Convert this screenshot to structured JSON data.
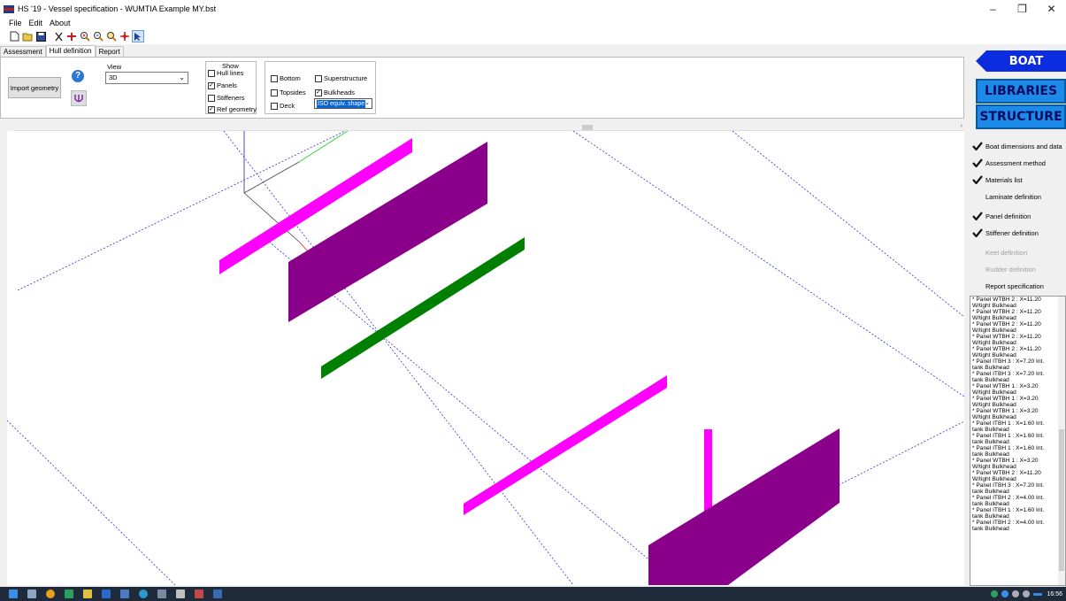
{
  "window": {
    "title": "HS '19 - Vessel specification - WUMTIA Example MY.bst",
    "minimize": "–",
    "maximize": "❐",
    "close": "✕"
  },
  "menu": [
    "File",
    "Edit",
    "About"
  ],
  "toolbar": [
    "new-icon",
    "open-icon",
    "save-icon",
    "cut-icon",
    "split-icon",
    "zoom-in-icon",
    "zoom-out-icon",
    "zoom-fit-icon",
    "pan-icon",
    "select-icon"
  ],
  "tabs": [
    {
      "label": "Assessment",
      "active": false
    },
    {
      "label": "Hull definition",
      "active": true
    },
    {
      "label": "Report",
      "active": false
    }
  ],
  "hull": {
    "import_label": "Import geometry",
    "help_glyph": "?",
    "view_label": "View",
    "view_value": "3D",
    "show_title": "Show",
    "show": [
      {
        "label": "Hull lines",
        "checked": false
      },
      {
        "label": "Panels",
        "checked": true
      },
      {
        "label": "Stiffeners",
        "checked": false
      },
      {
        "label": "Ref geometry",
        "checked": true
      }
    ],
    "regions": [
      {
        "label": "Bottom",
        "checked": false
      },
      {
        "label": "Topsides",
        "checked": false
      },
      {
        "label": "Deck",
        "checked": false
      },
      {
        "label": "Superstructure",
        "checked": false
      },
      {
        "label": "Bulkheads",
        "checked": true
      }
    ],
    "shape_value": "ISO equiv. shape"
  },
  "colors": {
    "magenta": "#ff00ff",
    "purple": "#8b008b",
    "green": "#008000",
    "boat_blue": "#0c2ce0",
    "lib_blue": "#1c8ae8"
  },
  "sidebar": {
    "boat": "BOAT",
    "libraries": "LIBRARIES",
    "structure": "STRUCTURE",
    "nav": [
      {
        "label": "Boat dimensions and data",
        "done": true,
        "disabled": false
      },
      {
        "label": "Assessment method",
        "done": true,
        "disabled": false
      },
      {
        "label": "Materials list",
        "done": true,
        "disabled": false
      },
      {
        "label": "Laminate definition",
        "done": false,
        "disabled": false
      },
      {
        "label": "Panel definition",
        "done": true,
        "disabled": false
      },
      {
        "label": "Stiffener definition",
        "done": true,
        "disabled": false
      },
      {
        "label": "Keel definition",
        "done": false,
        "disabled": true
      },
      {
        "label": "Rudder definition",
        "done": false,
        "disabled": true
      },
      {
        "label": "Report specification",
        "done": false,
        "disabled": false
      }
    ],
    "log": [
      "* Panel WTBH 2 : X=11.20",
      "W/tight Bulkhead",
      "* Panel WTBH 2 : X=11.20",
      "W/tight Bulkhead",
      "* Panel WTBH 2 : X=11.20",
      "W/tight Bulkhead",
      "* Panel WTBH 2 : X=11.20",
      "W/tight Bulkhead",
      "* Panel WTBH 2 : X=11.20",
      "W/tight Bulkhead",
      "* Panel ITBH 3 : X=7.20 Int.",
      "tank Bulkhead",
      "* Panel ITBH 3 : X=7.20 Int.",
      "tank Bulkhead",
      "* Panel WTBH 1 : X=3.20",
      "W/tight Bulkhead",
      "* Panel WTBH 1 : X=3.20",
      "W/tight Bulkhead",
      "* Panel WTBH 1 : X=3.20",
      "W/tight Bulkhead",
      "* Panel ITBH 1 : X=1.60 Int.",
      "tank Bulkhead",
      "* Panel ITBH 1 : X=1.60 Int.",
      "tank Bulkhead",
      "* Panel ITBH 1 : X=1.60 Int.",
      "tank Bulkhead",
      "* Panel WTBH 1 : X=3.20",
      "W/tight Bulkhead",
      "* Panel WTBH 2 : X=11.20",
      "W/tight Bulkhead",
      "* Panel ITBH 3 : X=7.20 Int.",
      "tank Bulkhead",
      "* Panel ITBH 2 : X=4.00 Int.",
      "tank Bulkhead",
      "* Panel ITBH 1 : X=1.60 Int.",
      "tank Bulkhead",
      "* Panel ITBH 2 : X=4.00 Int.",
      "tank Bulkhead"
    ]
  },
  "taskbar": {
    "clock": "16:56"
  }
}
